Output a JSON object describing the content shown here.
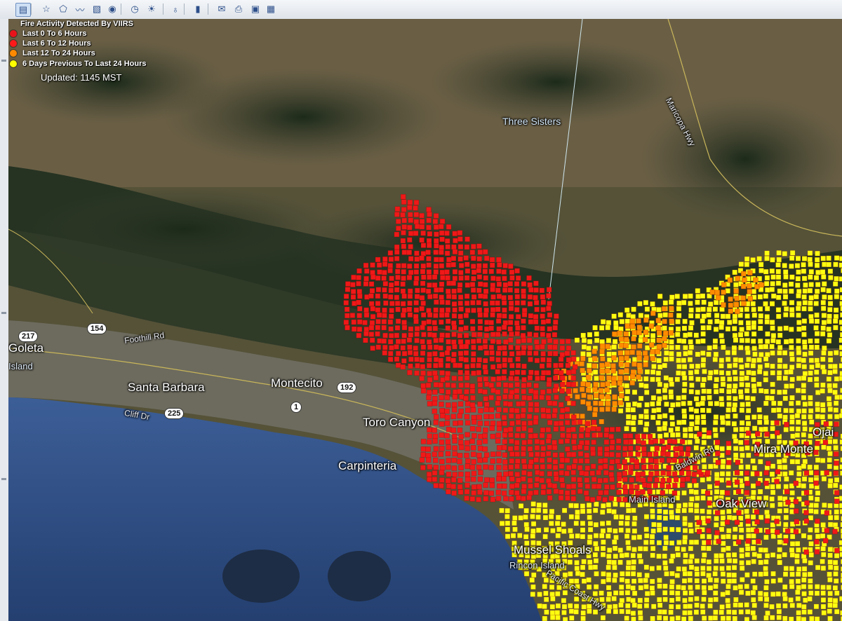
{
  "toolbar": {
    "buttons": [
      {
        "name": "sidebar-toggle-icon",
        "glyph": "▤"
      },
      {
        "name": "add-placemark-icon",
        "glyph": "☆"
      },
      {
        "name": "add-polygon-icon",
        "glyph": "⬠"
      },
      {
        "name": "add-path-icon",
        "glyph": "〰"
      },
      {
        "name": "image-overlay-icon",
        "glyph": "▧"
      },
      {
        "name": "record-tour-icon",
        "glyph": "◉"
      },
      {
        "name": "historical-imagery-icon",
        "glyph": "◷"
      },
      {
        "name": "sunlight-icon",
        "glyph": "☀"
      },
      {
        "name": "switch-to-sky-icon",
        "glyph": "♁"
      },
      {
        "name": "ruler-icon",
        "glyph": "▮"
      },
      {
        "name": "email-icon",
        "glyph": "✉"
      },
      {
        "name": "print-icon",
        "glyph": "⎙"
      },
      {
        "name": "save-image-icon",
        "glyph": "▣"
      },
      {
        "name": "view-in-maps-icon",
        "glyph": "▦"
      }
    ]
  },
  "legend": {
    "title": "Fire Activity Detected By VIIRS",
    "items": [
      {
        "label": "Last 0 To 6 Hours",
        "color": "#e8141b"
      },
      {
        "label": "Last 6 To 12 Hours",
        "color": "#ff1a1a"
      },
      {
        "label": "Last 12 To 24 Hours",
        "color": "#ff8a00"
      },
      {
        "label": "6 Days Previous To Last 24 Hours",
        "color": "#ffff00"
      }
    ],
    "updated": "Updated: 1145 MST"
  },
  "map": {
    "places": {
      "goleta": "Goleta",
      "island": "Island",
      "santa_barbara": "Santa Barbara",
      "montecito": "Montecito",
      "toro_canyon": "Toro Canyon",
      "carpinteria": "Carpinteria",
      "three_sisters": "Three Sisters",
      "mira_monte": "Mira Monte",
      "ojai": "Ojai",
      "oak_view": "Oak View",
      "main_island": "Main Island",
      "mussel_shoals": "Mussel Shoals",
      "rincon_island": "Rincon Island"
    },
    "roads": {
      "foothill": "Foothill Rd",
      "cliff": "Cliff Dr",
      "maricopa": "Maricopa Hwy",
      "baldwin": "Baldwin Rd",
      "pacific": "Pacific Coast Hwy"
    },
    "highways": {
      "h217": "217",
      "h154": "154",
      "h192": "192",
      "h225": "225",
      "h1": "1"
    },
    "colors": {
      "red": "#f01818",
      "orange": "#ff8c00",
      "yellow": "#ffff10",
      "ocean": "#2d4f86",
      "land": "#4b4d33",
      "urban": "#7a7a6e",
      "mountain_dark": "#22301f"
    }
  }
}
